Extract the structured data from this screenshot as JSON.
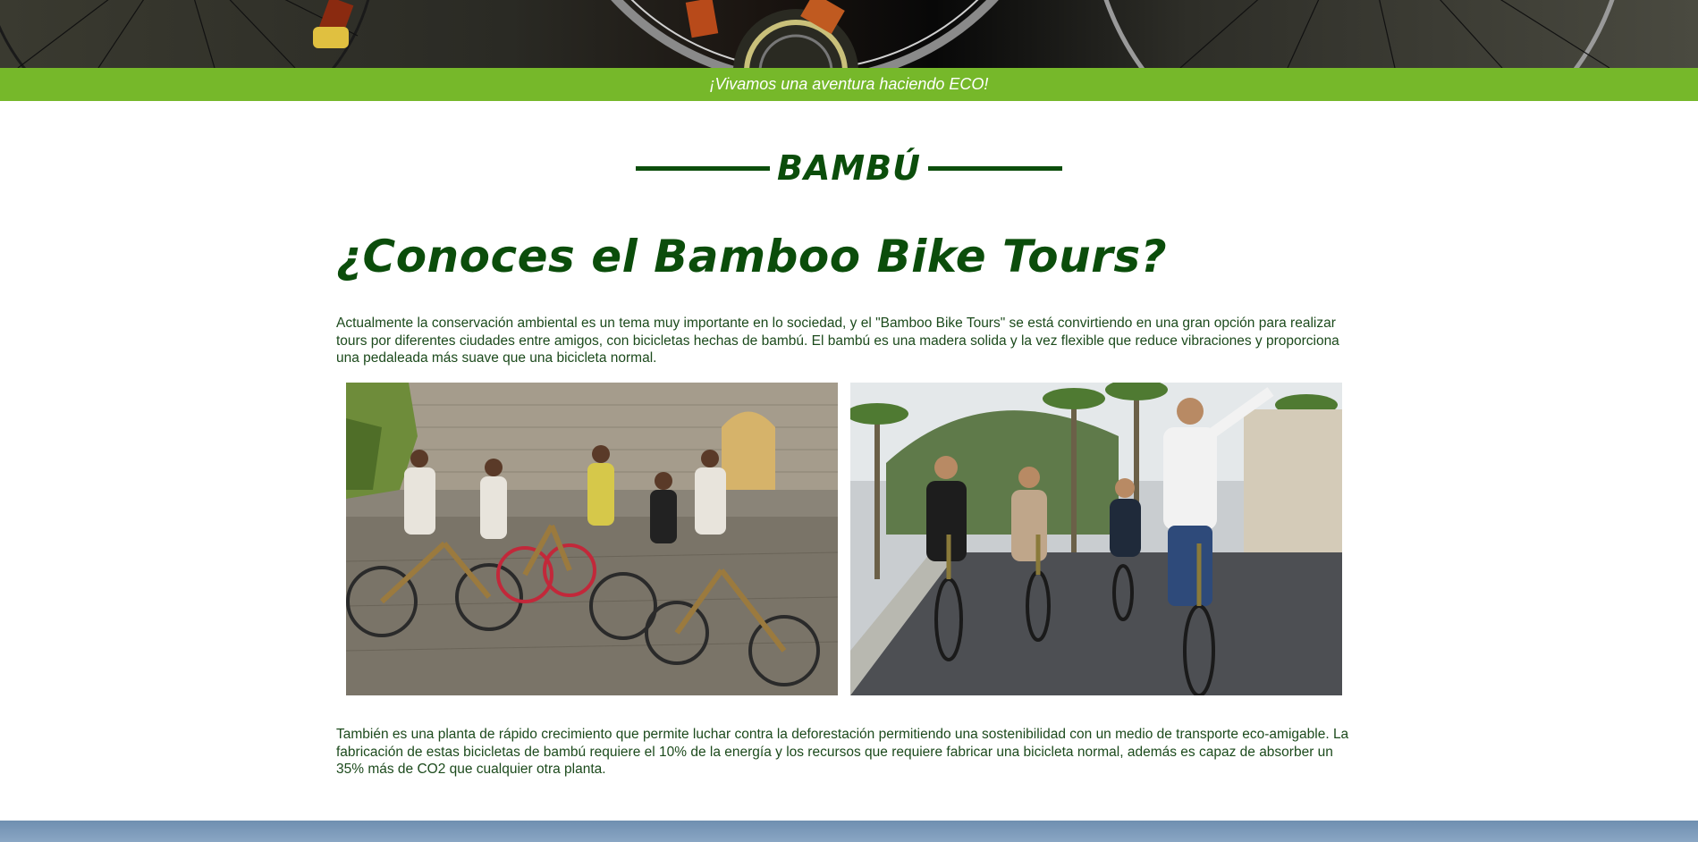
{
  "banner": {
    "text": "¡Vivamos una aventura haciendo ECO!"
  },
  "section": {
    "title": "BAMBÚ"
  },
  "article": {
    "heading": "¿Conoces el Bamboo Bike Tours?",
    "paragraph1": "Actualmente la conservación ambiental es un tema muy importante en lo sociedad, y el \"Bamboo Bike Tours\" se está convirtiendo en una gran opción para realizar tours por diferentes ciudades entre amigos, con bicicletas hechas de bambú. El bambú es una madera solida y la vez flexible que reduce vibraciones y proporciona una pedaleada más suave que una bicicleta normal.",
    "paragraph2": "También es una planta de rápido crecimiento que permite luchar contra la deforestación permitiendo una sostenibilidad con un medio de transporte eco-amigable. La fabricación de estas bicicletas de bambú requiere el 10% de la energía y los recursos que requiere fabricar una bicicleta normal, además es capaz de absorber un 35% más de CO2 que cualquier otra planta."
  },
  "colors": {
    "banner_green": "#76b82a",
    "title_green": "#0b4d0b",
    "text_green": "#1c4a1c"
  }
}
